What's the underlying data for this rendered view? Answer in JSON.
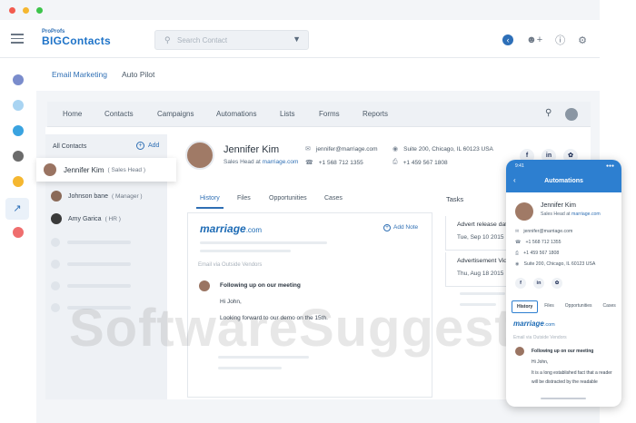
{
  "window": {
    "dot_colors": [
      "#f25b4f",
      "#f5b730",
      "#3dc44b"
    ]
  },
  "brand": {
    "small": "ProProfs",
    "big": "BIGContacts"
  },
  "search": {
    "placeholder": "Search Contact"
  },
  "rail_colors": [
    "#7a8ccc",
    "#a9d4f2",
    "#3aa3e0",
    "#6b6b6b",
    "#f5b730",
    "#2d6fb8",
    "#ef6e6e"
  ],
  "subnav": {
    "items": [
      "Email Marketing",
      "Auto Pilot"
    ]
  },
  "mainnav": {
    "items": [
      "Home",
      "Contacts",
      "Campaigns",
      "Automations",
      "Lists",
      "Forms",
      "Reports"
    ]
  },
  "contacts": {
    "header": "All Contacts",
    "add_label": "Add",
    "selected": {
      "name": "Jennifer Kim",
      "role": "( Sales Head )"
    },
    "rows": [
      {
        "name": "Johnson bane",
        "role": "( Manager )"
      },
      {
        "name": "Amy Garica",
        "role": "( HR )"
      }
    ]
  },
  "profile": {
    "name": "Jennifer Kim",
    "role_prefix": "Sales Head at",
    "company": "marriage.com",
    "email": "jennifer@marriage.com",
    "phone": "+1 568 712 1355",
    "address": "Suite 200, Chicago, IL 60123 USA",
    "fax": "+1 459 567 1808",
    "social": [
      "f",
      "in",
      "tw"
    ]
  },
  "tabs": [
    "History",
    "Files",
    "Opportunities",
    "Cases"
  ],
  "history": {
    "logo": "marriage",
    "logo_suffix": ".com",
    "add_note": "Add Note",
    "email_via": "Email via Outside Vendors",
    "msg_title": "Following up on our meeting",
    "msg_greeting": "Hi John,",
    "msg_body": "Looking forward to our demo on the 15th."
  },
  "tasks": {
    "header": "Tasks",
    "items": [
      {
        "title": "Advert release date",
        "date": "Tue, Sep 10 2015"
      },
      {
        "title": "Advertisement Vid",
        "date": "Thu, Aug 18 2015"
      }
    ]
  },
  "mobile": {
    "time": "9:41",
    "title": "Automations",
    "name": "Jennifer Kim",
    "role_prefix": "Sales Head at",
    "company": "marriage.com",
    "email": "jennifer@marriage.com",
    "phone": "+1 568 712 1355",
    "fax": "+1 459 567 1808",
    "address": "Suite 200, Chicago, IL 60123 USA",
    "tabs": [
      "History",
      "Files",
      "Opportunities",
      "Cases"
    ],
    "email_via": "Email via Outside Vendors",
    "msg_title": "Following up on our meeting",
    "msg_greeting": "Hi John,",
    "msg_line1": "It is a long established fact that a reader",
    "msg_line2": "will be distracted by the readable"
  },
  "watermark": "SoftwareSuggest."
}
